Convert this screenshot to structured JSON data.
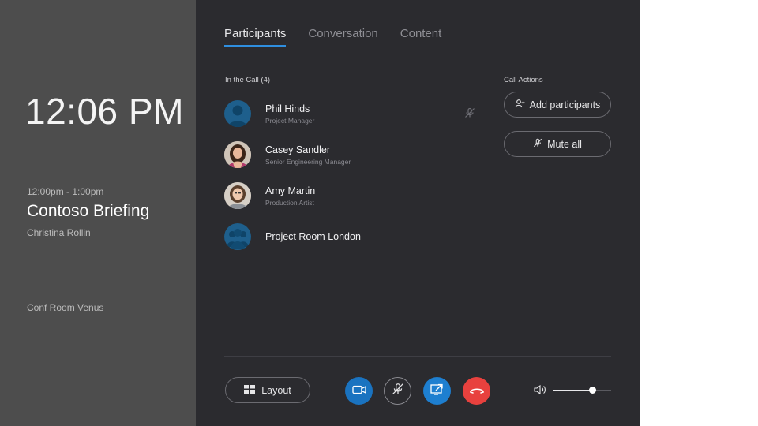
{
  "left_panel": {
    "clock": "12:06 PM",
    "meeting_time": "12:00pm - 1:00pm",
    "meeting_title": "Contoso Briefing",
    "organizer": "Christina Rollin",
    "room": "Conf Room Venus"
  },
  "tabs": [
    {
      "label": "Participants",
      "active": true
    },
    {
      "label": "Conversation",
      "active": false
    },
    {
      "label": "Content",
      "active": false
    }
  ],
  "in_call_label": "In the Call (4)",
  "participants": [
    {
      "name": "Phil Hinds",
      "role": "Project Manager",
      "avatar": "person-icon",
      "muted": true
    },
    {
      "name": "Casey Sandler",
      "role": "Senior Engineering Manager",
      "avatar": "photo"
    },
    {
      "name": "Amy Martin",
      "role": "Production Artist",
      "avatar": "photo"
    },
    {
      "name": "Project Room London",
      "role": "",
      "avatar": "group-icon"
    }
  ],
  "call_actions": {
    "label": "Call Actions",
    "add_participants": "Add participants",
    "mute_all": "Mute all"
  },
  "controls": {
    "layout_label": "Layout",
    "volume_level": 0.68
  },
  "colors": {
    "accent": "#2f8fe0",
    "video_button": "#1a73c0",
    "share_button": "#1e7fd0",
    "end_call": "#e8413e",
    "avatar_blue": "#1e5f8c"
  }
}
